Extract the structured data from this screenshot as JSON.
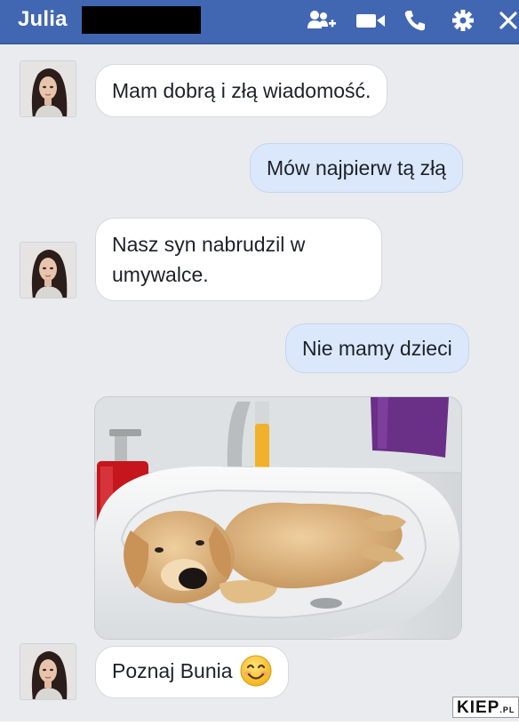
{
  "header": {
    "contact_name": "Julia",
    "icons": [
      "add-friend-icon",
      "video-call-icon",
      "phone-icon",
      "gear-icon",
      "close-icon"
    ]
  },
  "messages": [
    {
      "from": "contact",
      "text": "Mam dobrą i złą wiadomość."
    },
    {
      "from": "me",
      "text": "Mów najpierw tą złą"
    },
    {
      "from": "contact",
      "line1": "Nasz syn nabrudzil w",
      "line2": "umywalce."
    },
    {
      "from": "me",
      "text": "Nie mamy dzieci"
    },
    {
      "from": "contact",
      "type": "photo",
      "image": "puppy-in-sink"
    },
    {
      "from": "contact",
      "text": "Poznaj Bunia",
      "emoji": "smiling-face-emoji"
    }
  ],
  "watermark": {
    "main": "KIEP",
    "suffix": ".PL"
  },
  "colors": {
    "header": "#4267b2",
    "background": "#e9ebee",
    "outgoing_bubble": "#dbe8fb",
    "incoming_bubble": "#ffffff"
  }
}
